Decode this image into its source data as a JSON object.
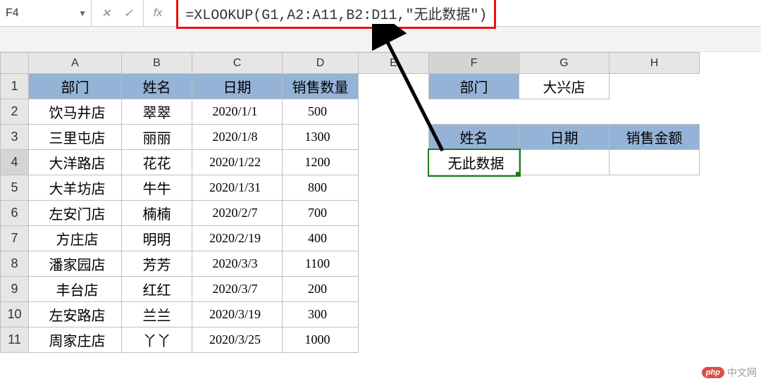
{
  "formula_bar": {
    "name_box": "F4",
    "fx_label": "fx",
    "formula": "=XLOOKUP(G1,A2:A11,B2:D11,\"无此数据\")"
  },
  "columns": [
    "A",
    "B",
    "C",
    "D",
    "E",
    "F",
    "G",
    "H"
  ],
  "rows": [
    "1",
    "2",
    "3",
    "4",
    "5",
    "6",
    "7",
    "8",
    "9",
    "10",
    "11"
  ],
  "main_table": {
    "headers": {
      "dept": "部门",
      "name": "姓名",
      "date": "日期",
      "qty": "销售数量"
    },
    "data": [
      {
        "dept": "饮马井店",
        "name": "翠翠",
        "date": "2020/1/1",
        "qty": "500"
      },
      {
        "dept": "三里屯店",
        "name": "丽丽",
        "date": "2020/1/8",
        "qty": "1300"
      },
      {
        "dept": "大洋路店",
        "name": "花花",
        "date": "2020/1/22",
        "qty": "1200"
      },
      {
        "dept": "大羊坊店",
        "name": "牛牛",
        "date": "2020/1/31",
        "qty": "800"
      },
      {
        "dept": "左安门店",
        "name": "楠楠",
        "date": "2020/2/7",
        "qty": "700"
      },
      {
        "dept": "方庄店",
        "name": "明明",
        "date": "2020/2/19",
        "qty": "400"
      },
      {
        "dept": "潘家园店",
        "name": "芳芳",
        "date": "2020/3/3",
        "qty": "1100"
      },
      {
        "dept": "丰台店",
        "name": "红红",
        "date": "2020/3/7",
        "qty": "200"
      },
      {
        "dept": "左安路店",
        "name": "兰兰",
        "date": "2020/3/19",
        "qty": "300"
      },
      {
        "dept": "周家庄店",
        "name": "丫丫",
        "date": "2020/3/25",
        "qty": "1000"
      }
    ]
  },
  "lookup_box": {
    "label_dept": "部门",
    "value_dept": "大兴店",
    "hdr_name": "姓名",
    "hdr_date": "日期",
    "hdr_amount": "销售金额",
    "result_f4": "无此数据"
  },
  "watermark": {
    "badge": "php",
    "text": "中文网"
  }
}
